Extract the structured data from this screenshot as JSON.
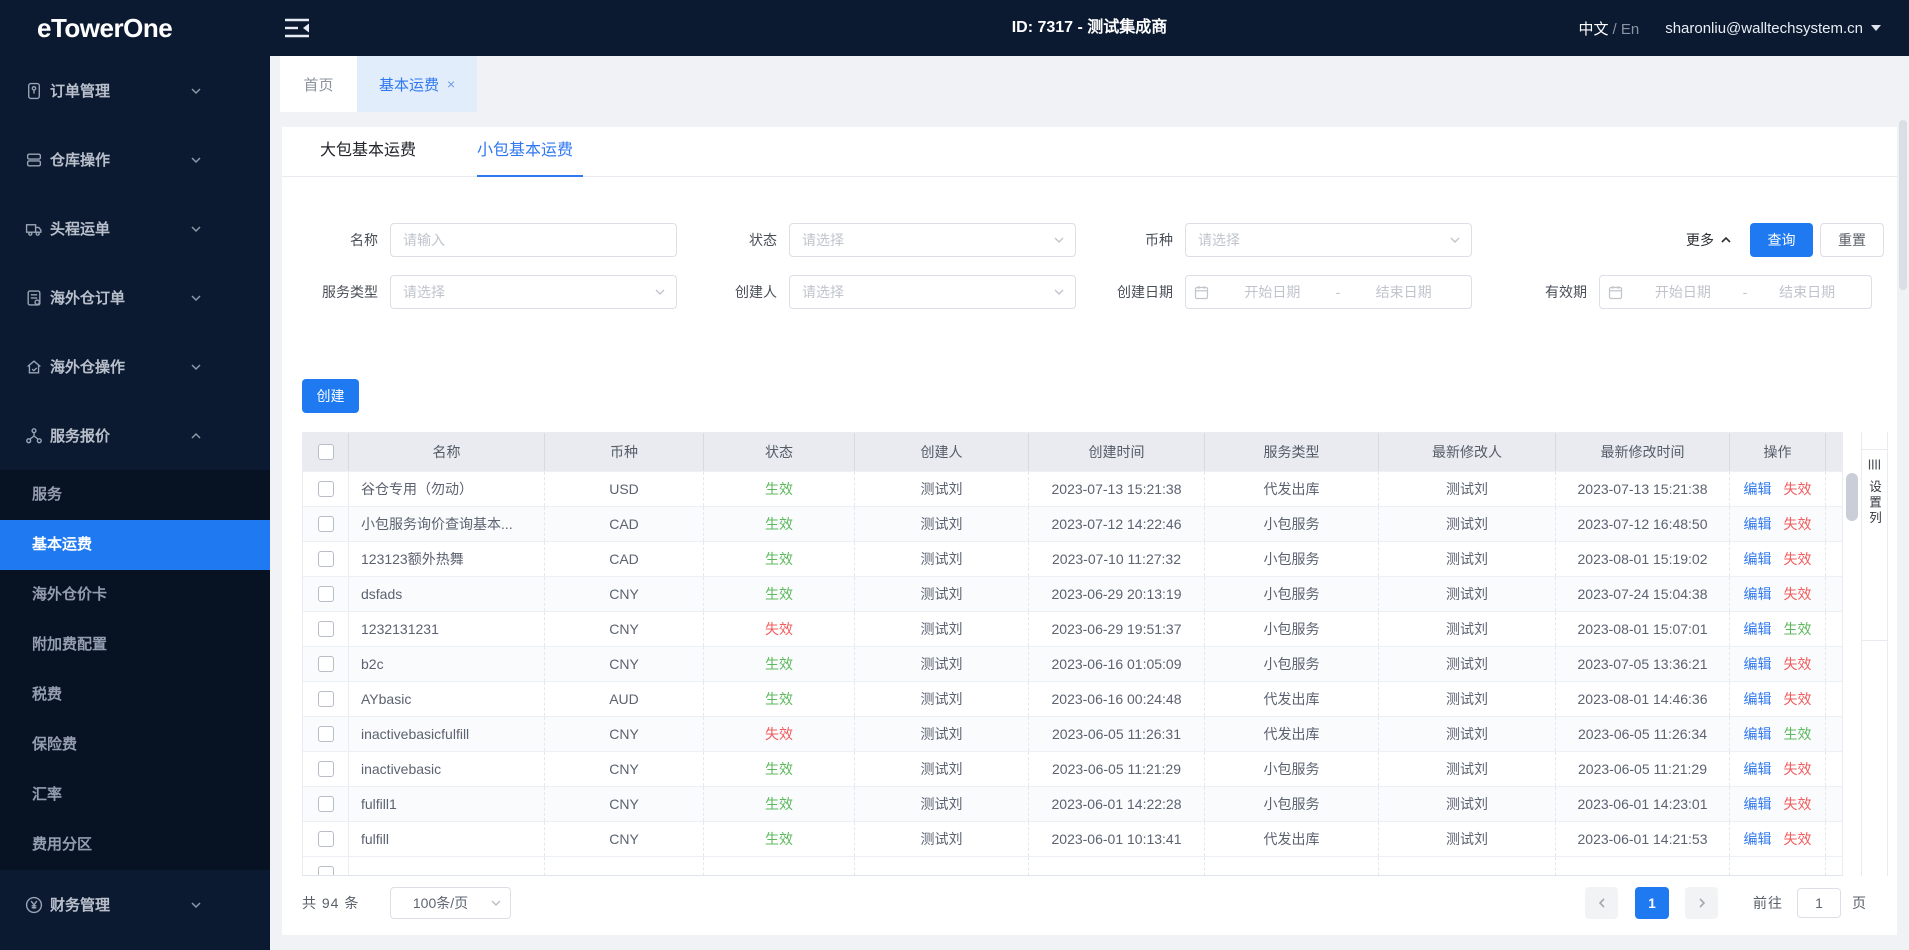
{
  "colors": {
    "accent": "#1f7af2",
    "link": "#3078f0",
    "success": "#5cb85c",
    "danger": "#f25c5c",
    "sidebar_bg": "#0b1a31",
    "submenu_bg": "#071222",
    "page_bg": "#f0f2f5"
  },
  "header": {
    "logo": "eTowerOne",
    "collapse_icon": "menu-fold-icon",
    "title": "ID: 7317 - 测试集成商",
    "lang_primary": "中文",
    "lang_secondary": "/ En",
    "user_email": "sharonliu@walltechsystem.cn",
    "user_caret_icon": "chevron-down-icon"
  },
  "sidebar": {
    "items": [
      {
        "label": "订单管理",
        "icon": "id-badge-icon"
      },
      {
        "label": "仓库操作",
        "icon": "warehouse-icon"
      },
      {
        "label": "头程运单",
        "icon": "truck-icon"
      },
      {
        "label": "海外仓订单",
        "icon": "document-icon"
      },
      {
        "label": "海外仓操作",
        "icon": "house-icon"
      },
      {
        "label": "服务报价",
        "icon": "share-network-icon",
        "expanded": true
      },
      {
        "label": "财务管理",
        "icon": "yen-coin-icon"
      }
    ],
    "submenu": {
      "items": [
        "服务",
        "基本运费",
        "海外仓价卡",
        "附加费配置",
        "税费",
        "保险费",
        "汇率",
        "费用分区"
      ],
      "active": "基本运费"
    }
  },
  "tabs": [
    {
      "label": "首页"
    },
    {
      "label": "基本运费",
      "closable": true,
      "active": true
    }
  ],
  "inner_tabs": [
    {
      "label": "大包基本运费"
    },
    {
      "label": "小包基本运费",
      "active": true
    }
  ],
  "filters": {
    "name": {
      "label": "名称",
      "placeholder": "请输入"
    },
    "status": {
      "label": "状态",
      "placeholder": "请选择"
    },
    "currency": {
      "label": "币种",
      "placeholder": "请选择"
    },
    "service_type": {
      "label": "服务类型",
      "placeholder": "请选择"
    },
    "creator": {
      "label": "创建人",
      "placeholder": "请选择"
    },
    "create_date": {
      "label": "创建日期",
      "start": "开始日期",
      "separator": "-",
      "end": "结束日期",
      "icon": "calendar-icon"
    },
    "valid_period": {
      "label": "有效期",
      "start": "开始日期",
      "separator": "-",
      "end": "结束日期",
      "icon": "calendar-icon"
    },
    "more_label": "更多",
    "search_label": "查询",
    "reset_label": "重置"
  },
  "toolbar": {
    "create_label": "创建"
  },
  "table": {
    "columns": [
      "名称",
      "币种",
      "状态",
      "创建人",
      "创建时间",
      "服务类型",
      "最新修改人",
      "最新修改时间",
      "操作"
    ],
    "edit_label": "编辑",
    "column_settings_label": "设置列",
    "column_settings_icon": "columns-icon",
    "rows": [
      {
        "name": "谷仓专用（勿动）",
        "currency": "USD",
        "status": "生效",
        "status_kind": "active",
        "creator": "测试刘",
        "created": "2023-07-13 15:21:38",
        "service": "代发出库",
        "modifier": "测试刘",
        "modified": "2023-07-13 15:21:38",
        "toggle": "失效",
        "toggle_kind": "danger"
      },
      {
        "name": "小包服务询价查询基本...",
        "currency": "CAD",
        "status": "生效",
        "status_kind": "active",
        "creator": "测试刘",
        "created": "2023-07-12 14:22:46",
        "service": "小包服务",
        "modifier": "测试刘",
        "modified": "2023-07-12 16:48:50",
        "toggle": "失效",
        "toggle_kind": "danger"
      },
      {
        "name": "123123额外热舞",
        "currency": "CAD",
        "status": "生效",
        "status_kind": "active",
        "creator": "测试刘",
        "created": "2023-07-10 11:27:32",
        "service": "小包服务",
        "modifier": "测试刘",
        "modified": "2023-08-01 15:19:02",
        "toggle": "失效",
        "toggle_kind": "danger"
      },
      {
        "name": "dsfads",
        "currency": "CNY",
        "status": "生效",
        "status_kind": "active",
        "creator": "测试刘",
        "created": "2023-06-29 20:13:19",
        "service": "小包服务",
        "modifier": "测试刘",
        "modified": "2023-07-24 15:04:38",
        "toggle": "失效",
        "toggle_kind": "danger"
      },
      {
        "name": "1232131231",
        "currency": "CNY",
        "status": "失效",
        "status_kind": "inactive",
        "creator": "测试刘",
        "created": "2023-06-29 19:51:37",
        "service": "小包服务",
        "modifier": "测试刘",
        "modified": "2023-08-01 15:07:01",
        "toggle": "生效",
        "toggle_kind": "success"
      },
      {
        "name": "b2c",
        "currency": "CNY",
        "status": "生效",
        "status_kind": "active",
        "creator": "测试刘",
        "created": "2023-06-16 01:05:09",
        "service": "小包服务",
        "modifier": "测试刘",
        "modified": "2023-07-05 13:36:21",
        "toggle": "失效",
        "toggle_kind": "danger"
      },
      {
        "name": "AYbasic",
        "currency": "AUD",
        "status": "生效",
        "status_kind": "active",
        "creator": "测试刘",
        "created": "2023-06-16 00:24:48",
        "service": "代发出库",
        "modifier": "测试刘",
        "modified": "2023-08-01 14:46:36",
        "toggle": "失效",
        "toggle_kind": "danger"
      },
      {
        "name": "inactivebasicfulfill",
        "currency": "CNY",
        "status": "失效",
        "status_kind": "inactive",
        "creator": "测试刘",
        "created": "2023-06-05 11:26:31",
        "service": "代发出库",
        "modifier": "测试刘",
        "modified": "2023-06-05 11:26:34",
        "toggle": "生效",
        "toggle_kind": "success"
      },
      {
        "name": "inactivebasic",
        "currency": "CNY",
        "status": "生效",
        "status_kind": "active",
        "creator": "测试刘",
        "created": "2023-06-05 11:21:29",
        "service": "小包服务",
        "modifier": "测试刘",
        "modified": "2023-06-05 11:21:29",
        "toggle": "失效",
        "toggle_kind": "danger"
      },
      {
        "name": "fulfill1",
        "currency": "CNY",
        "status": "生效",
        "status_kind": "active",
        "creator": "测试刘",
        "created": "2023-06-01 14:22:28",
        "service": "小包服务",
        "modifier": "测试刘",
        "modified": "2023-06-01 14:23:01",
        "toggle": "失效",
        "toggle_kind": "danger"
      },
      {
        "name": "fulfill",
        "currency": "CNY",
        "status": "生效",
        "status_kind": "active",
        "creator": "测试刘",
        "created": "2023-06-01 10:13:41",
        "service": "代发出库",
        "modifier": "测试刘",
        "modified": "2023-06-01 14:21:53",
        "toggle": "失效",
        "toggle_kind": "danger"
      }
    ]
  },
  "pagination": {
    "total": "共 94 条",
    "page_size": "100条/页",
    "current_page": "1",
    "goto_label": "前往",
    "goto_value": "1",
    "page_unit": "页"
  }
}
